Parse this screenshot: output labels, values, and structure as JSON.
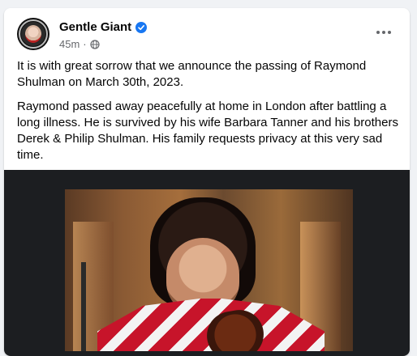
{
  "post": {
    "page_name": "Gentle Giant",
    "timestamp": "45m",
    "separator": "·",
    "paragraphs": [
      "It is with great sorrow that we announce the passing of Raymond Shulman on March 30th, 2023.",
      "Raymond passed away peacefully at home in London after battling a long illness. He is survived by his wife Barbara Tanner and his brothers Derek & Philip Shulman. His family requests privacy at this very sad time."
    ]
  },
  "icons": {
    "verified": "verified-badge-icon",
    "audience": "globe-icon",
    "more": "more-options-icon"
  },
  "colors": {
    "accent": "#1877f2",
    "secondary_text": "#65676b",
    "primary_text": "#050505",
    "background": "#f0f2f5"
  }
}
